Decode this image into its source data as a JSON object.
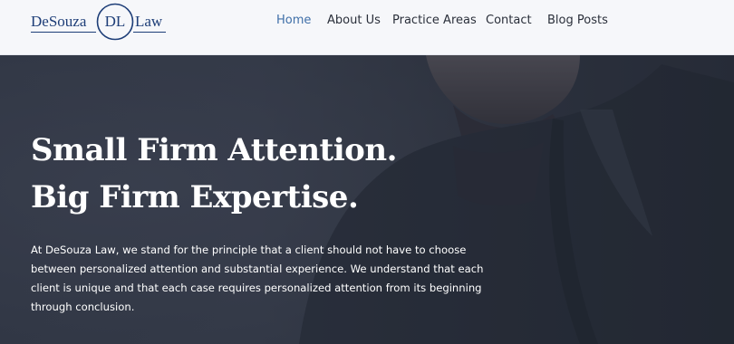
{
  "header": {
    "logo": {
      "left_text": "DeSouza",
      "monogram": "DL",
      "right_text": "Law",
      "color": "#1e3e78"
    },
    "nav": [
      {
        "label": "Home",
        "active": true
      },
      {
        "label": "About Us",
        "active": false
      },
      {
        "label": "Practice Areas",
        "active": false
      },
      {
        "label": "Contact",
        "active": false
      },
      {
        "label": "Blog Posts",
        "active": false
      }
    ],
    "active_color": "#3f6fa8"
  },
  "hero": {
    "title_line1": "Small Firm Attention.",
    "title_line2": "Big Firm Expertise.",
    "body": "At DeSouza Law, we stand for the principle that a client should not have to choose between personalized attention and substantial experience. We understand that each client is unique and that each case requires personalized attention from its beginning through conclusion.",
    "background_image": "man-in-suit-photo"
  }
}
